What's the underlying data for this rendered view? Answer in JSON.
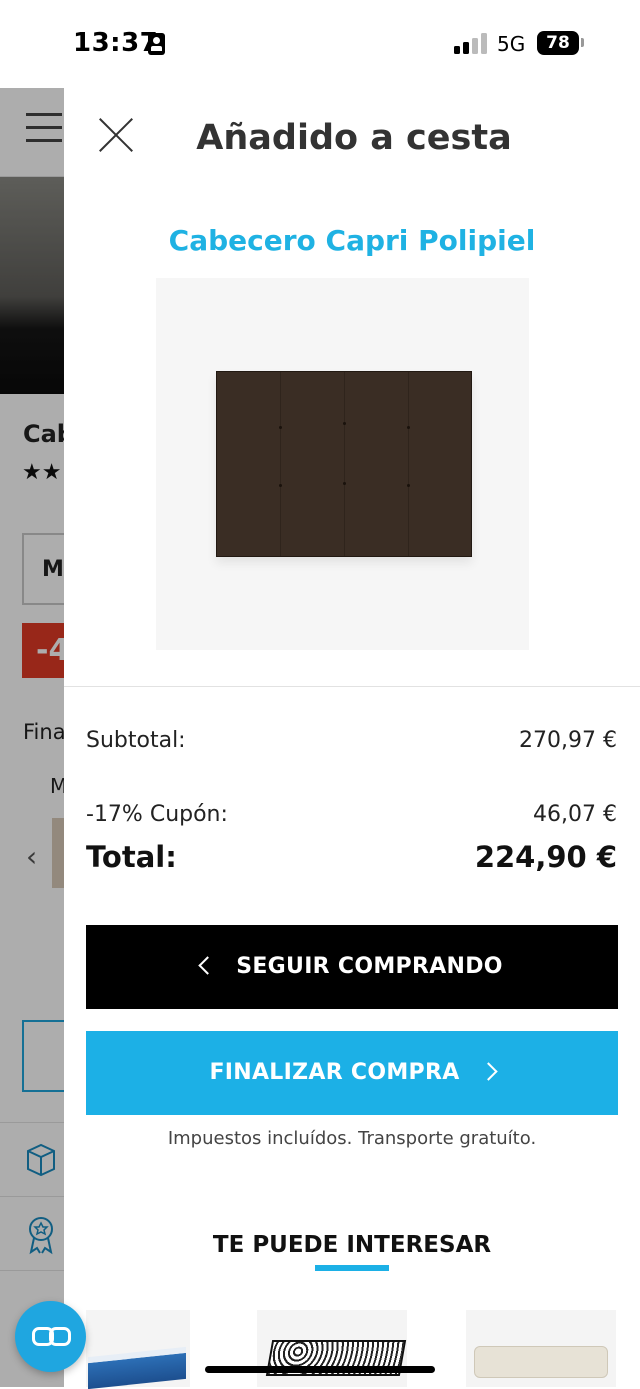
{
  "status_bar": {
    "time": "13:37",
    "network": "5G",
    "battery": "78"
  },
  "background_page": {
    "title_partial": "Cab",
    "stars": "★★",
    "select_partial": "M",
    "discount_partial": "-4",
    "section_partial": "Fina",
    "label_partial": "M"
  },
  "drawer": {
    "title": "Añadido a cesta",
    "product_name": "Cabecero Capri Polipiel",
    "summary": {
      "subtotal_label": "Subtotal:",
      "subtotal_value": "270,97 €",
      "coupon_label": "-17% Cupón:",
      "coupon_value": "46,07 €",
      "total_label": "Total:",
      "total_value": "224,90 €"
    },
    "continue_button": "SEGUIR COMPRANDO",
    "checkout_button": "FINALIZAR COMPRA",
    "note": "Impuestos incluídos. Transporte gratuíto.",
    "recommendations_title": "TE PUEDE INTERESAR"
  },
  "colors": {
    "accent": "#1cb0e6",
    "product_name": "#1fb2e3",
    "primary_button": "#000000",
    "discount_badge": "#e03a25"
  }
}
